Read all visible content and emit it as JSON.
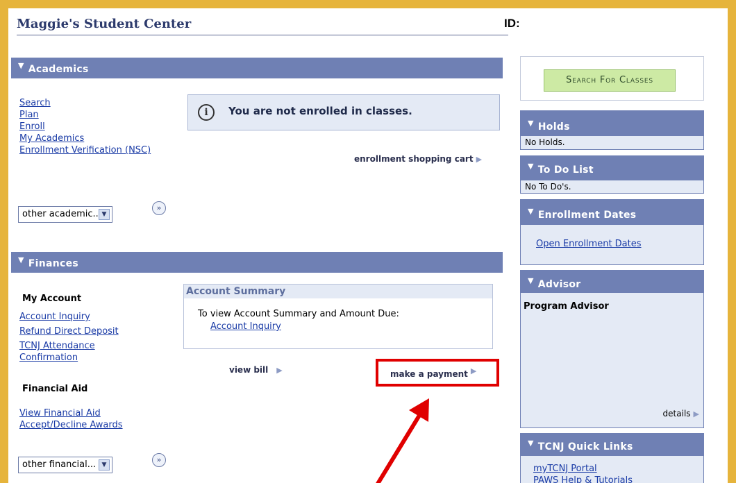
{
  "header": {
    "title": "Maggie's Student Center",
    "id_label": "ID:"
  },
  "academics": {
    "title": "Academics",
    "links": [
      "Search",
      "Plan",
      "Enroll",
      "My Academics",
      "Enrollment Verification (NSC)"
    ],
    "notice": "You are not enrolled in classes.",
    "shopping_cart_link": "enrollment shopping cart",
    "other_select": "other academic..."
  },
  "finances": {
    "title": "Finances",
    "my_account_heading": "My Account",
    "my_account_links": [
      "Account Inquiry",
      "Refund Direct Deposit",
      "TCNJ Attendance",
      "Confirmation"
    ],
    "account_summary": {
      "title": "Account Summary",
      "text": "To view Account Summary and Amount Due:",
      "link": "Account Inquiry"
    },
    "view_bill": "view bill",
    "make_payment": "make a payment",
    "financial_aid_heading": "Financial Aid",
    "financial_aid_links": [
      "View Financial Aid",
      "Accept/Decline Awards"
    ],
    "other_select": "other financial..."
  },
  "sidebar": {
    "search_button": "Search For Classes",
    "holds": {
      "title": "Holds",
      "text": "No Holds."
    },
    "todo": {
      "title": "To Do List",
      "text": "No To Do's."
    },
    "enrollment_dates": {
      "title": "Enrollment Dates",
      "link": "Open Enrollment Dates"
    },
    "advisor": {
      "title": "Advisor",
      "heading": "Program Advisor",
      "details": "details"
    },
    "quick_links": {
      "title": "TCNJ Quick Links",
      "links": [
        "myTCNJ Portal",
        "PAWS Help & Tutorials"
      ]
    }
  },
  "colors": {
    "frame": "#E6B43C",
    "section_bar": "#6F80B4",
    "panel_bg": "#E4EAF5",
    "link": "#1A3BA6",
    "highlight": "#E00000",
    "search_button": "#CDEAA4"
  },
  "icons": [
    "triangle-down-icon",
    "info-icon",
    "triangle-right-icon",
    "dropdown-arrow-icon",
    "double-chevron-right-icon",
    "red-arrow-annotation"
  ]
}
